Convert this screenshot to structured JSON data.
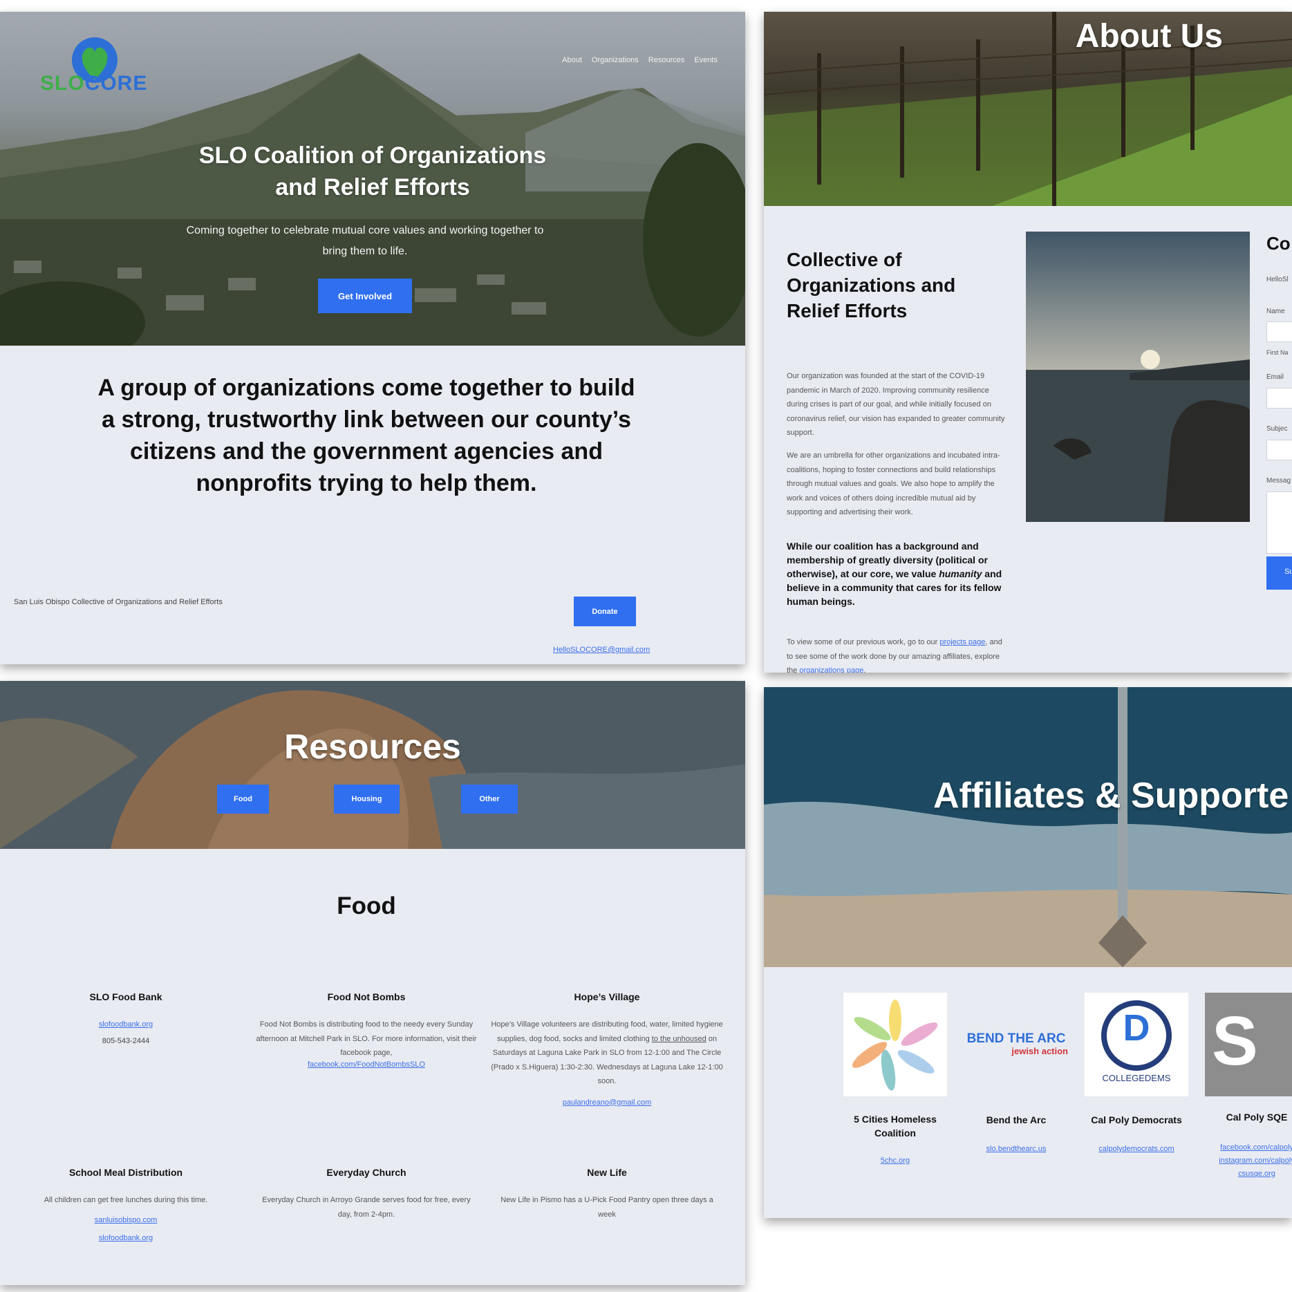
{
  "home": {
    "logo_slo": "SLO",
    "logo_core": "CORE",
    "nav": [
      "About",
      "Organizations",
      "Resources",
      "Events"
    ],
    "hero_title_line1": "SLO Coalition of Organizations",
    "hero_title_line2": "and Relief Efforts",
    "hero_sub": "Coming together to celebrate mutual core values and working together to bring them to life.",
    "cta_label": "Get Involved",
    "statement": "A group of organizations come together to build a strong, trustworthy link between our county’s citizens and the government agencies and nonprofits trying to help them.",
    "footer_text": "San Luis Obispo Collective of Organizations and Relief Efforts",
    "donate_label": "Donate",
    "email": "HelloSLOCORE@gmail.com"
  },
  "about": {
    "title": "About Us",
    "heading": "Collective of Organizations and Relief Efforts",
    "para1": "Our organization was founded at the start of the COVID-19 pandemic in March of 2020. Improving community resilience during crises is part of our goal, and while initially focused on coronavirus relief, our vision has expanded to greater community support.",
    "para2": "We are an umbrella for other organizations and incubated intra-coalitions, hoping to foster connections and build relationships through mutual values and goals. We also hope to amplify the work and voices of others doing incredible mutual aid by supporting and advertising their work.",
    "bold_pre": "While our coalition has a background and membership of greatly diversity (political or otherwise), at our core, we value ",
    "bold_em": "humanity",
    "bold_post": " and believe in a community that cares for its fellow human beings.",
    "links_pre": "To view some of our previous work, go to our ",
    "link_projects": "projects page",
    "links_mid": ", and to see some of the work done by our amazing affiliates, explore the ",
    "link_orgs": "organizations page",
    "links_end": ".",
    "contact_heading": "Co",
    "contact_email_text": "HelloSl",
    "label_name": "Name",
    "label_first": "First Na",
    "label_email": "Email",
    "label_subject": "Subjec",
    "label_message": "Messag",
    "submit_label": "Su"
  },
  "resources": {
    "title": "Resources",
    "tabs": [
      "Food",
      "Housing",
      "Other"
    ],
    "section_title": "Food",
    "items": [
      {
        "name": "SLO Food Bank",
        "link": "slofoodbank.org",
        "phone": "805-543-2444"
      },
      {
        "name": "Food Not Bombs",
        "desc": "Food Not Bombs is distributing food to the needy every Sunday afternoon at Mitchell Park in SLO. For more information, visit their facebook page,",
        "link": "facebook.com/FoodNotBombsSLO"
      },
      {
        "name": "Hope’s Village",
        "desc_pre": "Hope’s Village volunteers are distributing food, water, limited hygiene supplies, dog food, socks and limited clothing ",
        "desc_u": "to the unhoused",
        "desc_post": " on Saturdays at Laguna Lake Park in SLO from 12-1:00 and The Circle (Prado x S.Higuera) 1:30-2:30. Wednesdays at Laguna Lake 12-1:00 soon.",
        "link": "paulandreano@gmail.com"
      },
      {
        "name": "School Meal Distribution",
        "desc": "All children can get free lunches during this time.",
        "link1": "sanluisobispo.com",
        "link2": "slofoodbank.org"
      },
      {
        "name": "Everyday Church",
        "desc": "Everyday Church in Arroyo Grande serves food for free, every day, from 2-4pm."
      },
      {
        "name": "New Life",
        "desc": "New Life in Pismo has a U-Pick Food Pantry open three days a week"
      }
    ]
  },
  "affiliates": {
    "title": "Affiliates & Supporte",
    "items": [
      {
        "name": "5 Cities Homeless Coalition",
        "link": "5chc.org"
      },
      {
        "name": "Bend the Arc",
        "logo_top": "BEND THE ARC",
        "logo_bottom": "jewish action",
        "link": "slo.bendthearc.us"
      },
      {
        "name": "Cal Poly Democrats",
        "logo_text": "COLLEGEDEMS",
        "logo_letter": "D",
        "link": "calpolydemocrats.com"
      },
      {
        "name": "Cal Poly SQE",
        "logo_text": "S",
        "links": [
          "facebook.com/calpoly",
          "instagram.com/calpoly",
          "csusqe.org"
        ]
      }
    ]
  },
  "colors": {
    "accent": "#2f6ff0",
    "panel_bg": "#e9ebf3",
    "logo_green": "#3fae49",
    "logo_blue": "#2d6fd6"
  }
}
